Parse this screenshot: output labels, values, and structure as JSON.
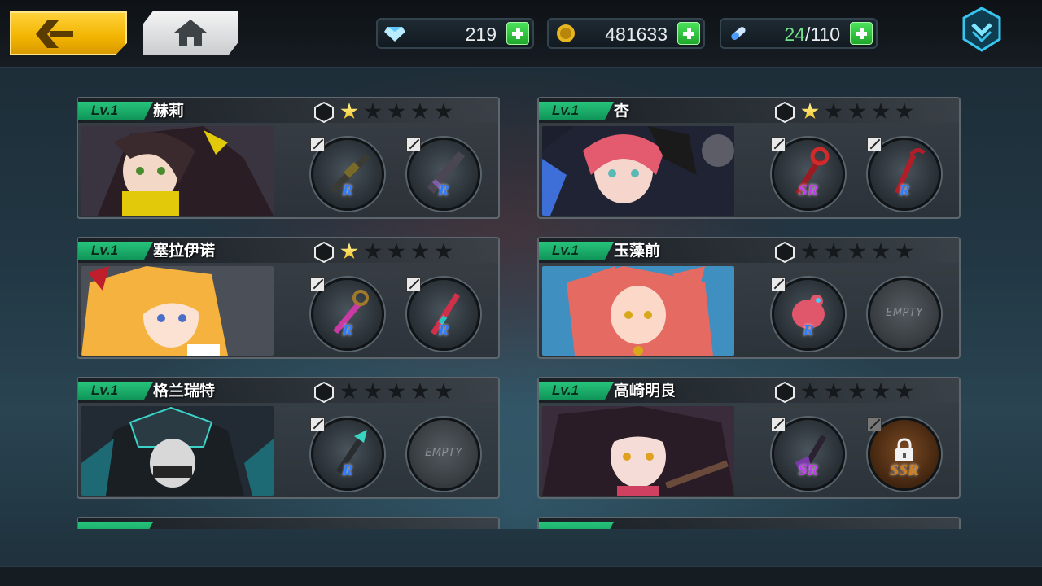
{
  "topbar": {
    "back_icon": "chevron-left-icon",
    "home_icon": "home-icon",
    "menu_icon": "chevron-down-shield-icon",
    "diamonds": {
      "icon": "diamond-icon",
      "value": "219"
    },
    "gold": {
      "icon": "gold-coin-icon",
      "value": "481633"
    },
    "stamina": {
      "icon": "stamina-capsule-icon",
      "current": "24",
      "sep_max": "/110"
    }
  },
  "colors": {
    "accent": "#f2b400",
    "level_tag": "#1fa86a",
    "plus": "#2cc03b"
  },
  "cards": [
    {
      "level": "Lv.1",
      "name": "赫莉",
      "stars": 1,
      "slots": [
        {
          "type": "weapon",
          "rarity": "R"
        },
        {
          "type": "weapon",
          "rarity": "R"
        }
      ]
    },
    {
      "level": "Lv.1",
      "name": "杏",
      "stars": 1,
      "slots": [
        {
          "type": "weapon",
          "rarity": "SR"
        },
        {
          "type": "weapon",
          "rarity": "R"
        }
      ]
    },
    {
      "level": "Lv.1",
      "name": "塞拉伊诺",
      "stars": 1,
      "slots": [
        {
          "type": "weapon",
          "rarity": "R"
        },
        {
          "type": "weapon",
          "rarity": "R"
        }
      ]
    },
    {
      "level": "Lv.1",
      "name": "玉藻前",
      "stars": 0,
      "slots": [
        {
          "type": "weapon",
          "rarity": "R"
        },
        {
          "type": "empty",
          "label": "EMPTY"
        }
      ]
    },
    {
      "level": "Lv.1",
      "name": "格兰瑞特",
      "stars": 0,
      "slots": [
        {
          "type": "weapon",
          "rarity": "R"
        },
        {
          "type": "empty",
          "label": "EMPTY"
        }
      ]
    },
    {
      "level": "Lv.1",
      "name": "高崎明良",
      "stars": 0,
      "slots": [
        {
          "type": "weapon",
          "rarity": "SR"
        },
        {
          "type": "locked",
          "rarity": "SSR"
        }
      ]
    }
  ]
}
